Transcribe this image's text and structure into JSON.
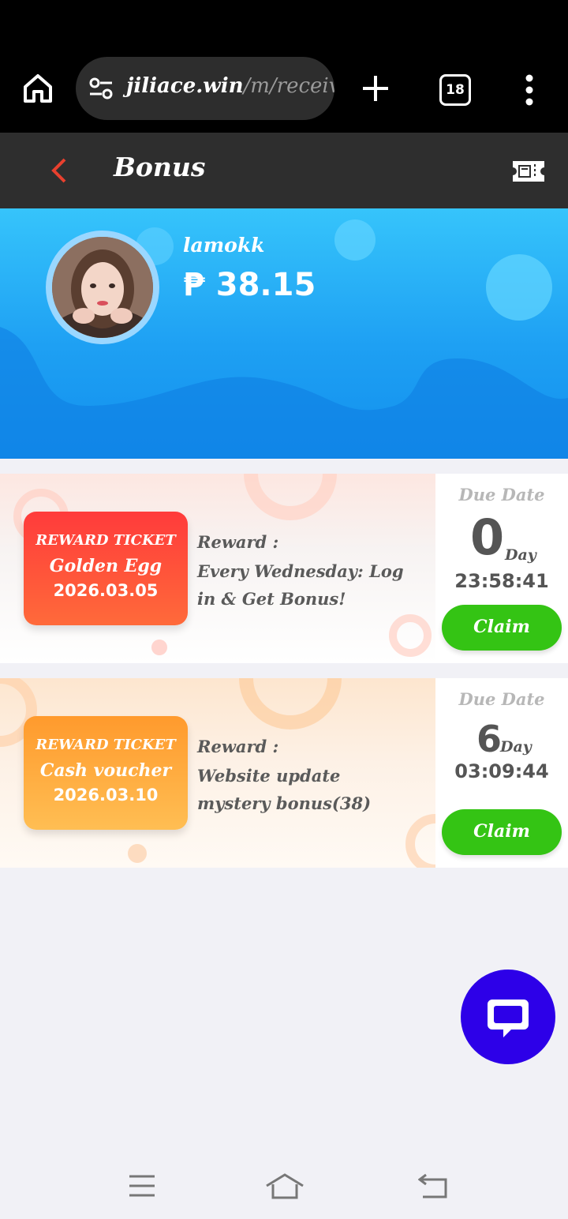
{
  "browser": {
    "url_domain": "jiliace.win",
    "url_path": "/m/receiving",
    "tab_count": "18",
    "icons": [
      "home-icon",
      "site-settings-icon",
      "new-tab-icon",
      "tabs-icon",
      "more-vert-icon"
    ]
  },
  "header": {
    "title": "Bonus",
    "icons": [
      "back-chevron-icon",
      "ticket-icon"
    ],
    "colors": {
      "back": "#e8402e",
      "bar": "#2e2e2e"
    }
  },
  "profile": {
    "username": "lamokk",
    "balance": "₱ 38.15"
  },
  "rewards": [
    {
      "ticket_heading": "REWARD TICKET",
      "ticket_name": "Golden Egg",
      "ticket_date": "2026.03.05",
      "reward_label": "Reward :",
      "reward_desc": "Every Wednesday: Log in & Get Bonus!",
      "due_label": "Due Date",
      "days": "0",
      "day_word": "Day",
      "time": "23:58:41",
      "claim_label": "Claim"
    },
    {
      "ticket_heading": "REWARD TICKET",
      "ticket_name": "Cash voucher",
      "ticket_date": "2026.03.10",
      "reward_label": "Reward :",
      "reward_desc": "Website update mystery bonus(38)",
      "due_label": "Due Date",
      "days": "6",
      "day_word": "Day",
      "time": "03:09:44",
      "claim_label": "Claim"
    }
  ],
  "chat": {
    "icon": "chat-bubble-icon",
    "color": "#2d00e8"
  },
  "nav": {
    "icons": [
      "menu-icon",
      "home-outline-icon",
      "back-icon"
    ]
  },
  "colors": {
    "claim": "#34c414",
    "hero": "#1ea0f3",
    "ticket_red": "#ff3b3b",
    "ticket_orange": "#ff9a2d"
  }
}
